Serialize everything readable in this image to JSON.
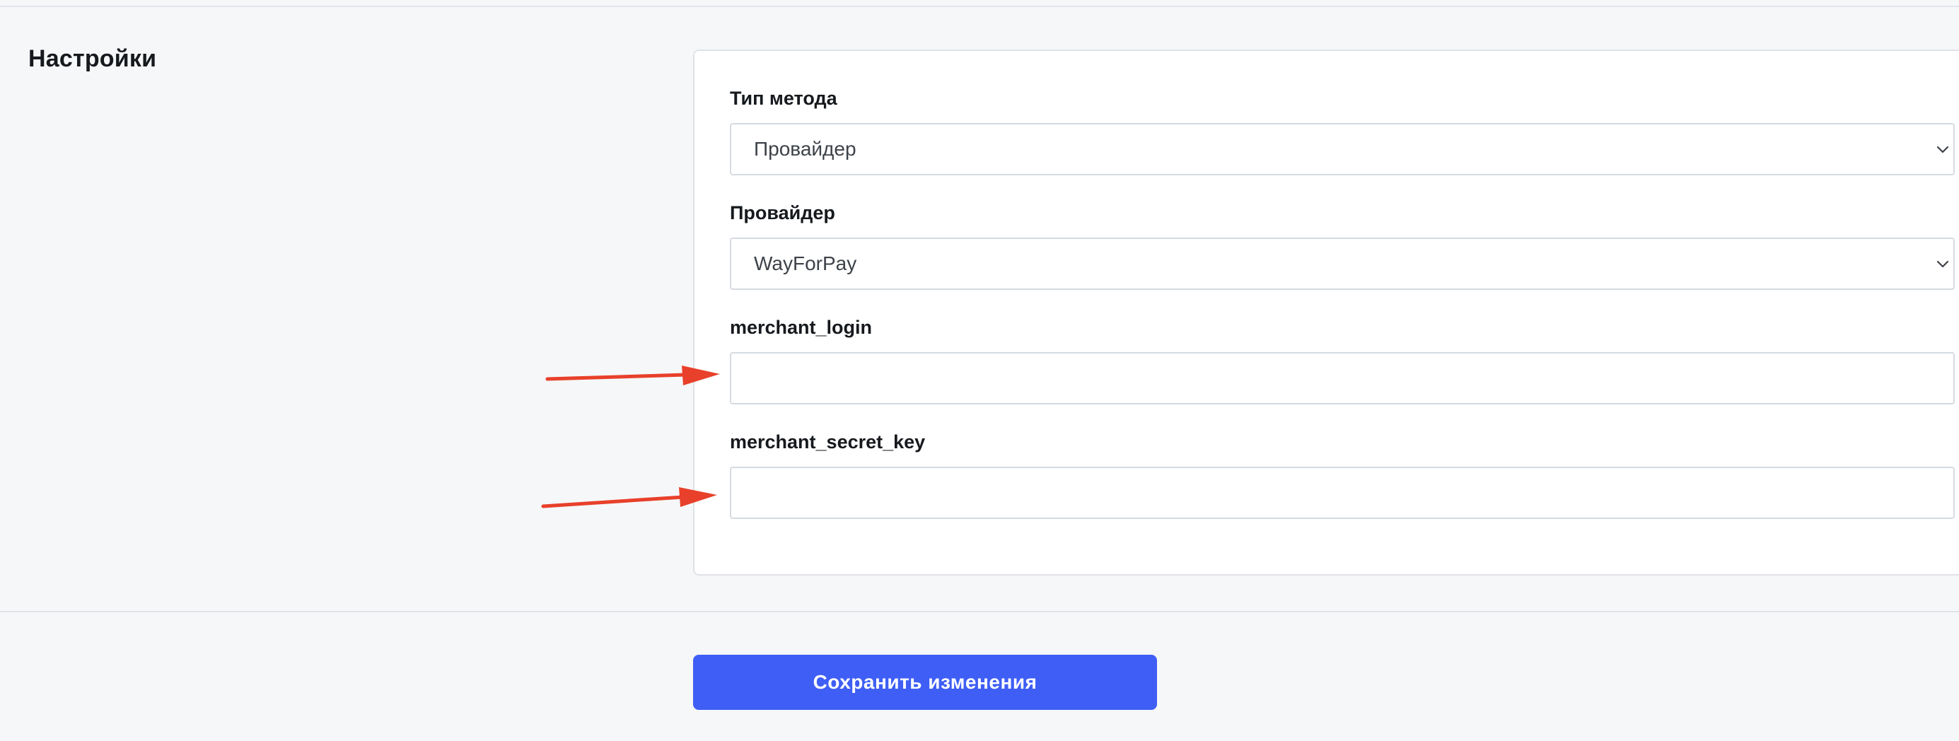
{
  "section": {
    "title": "Настройки"
  },
  "form": {
    "method_type": {
      "label": "Тип метода",
      "value": "Провайдер"
    },
    "provider": {
      "label": "Провайдер",
      "value": "WayForPay"
    },
    "merchant_login": {
      "label": "merchant_login",
      "value": ""
    },
    "merchant_secret_key": {
      "label": "merchant_secret_key",
      "value": ""
    }
  },
  "actions": {
    "save_label": "Сохранить изменения"
  },
  "colors": {
    "background": "#f6f7f9",
    "card": "#ffffff",
    "accent": "#3f5ef5",
    "annotation": "#e8402a"
  }
}
